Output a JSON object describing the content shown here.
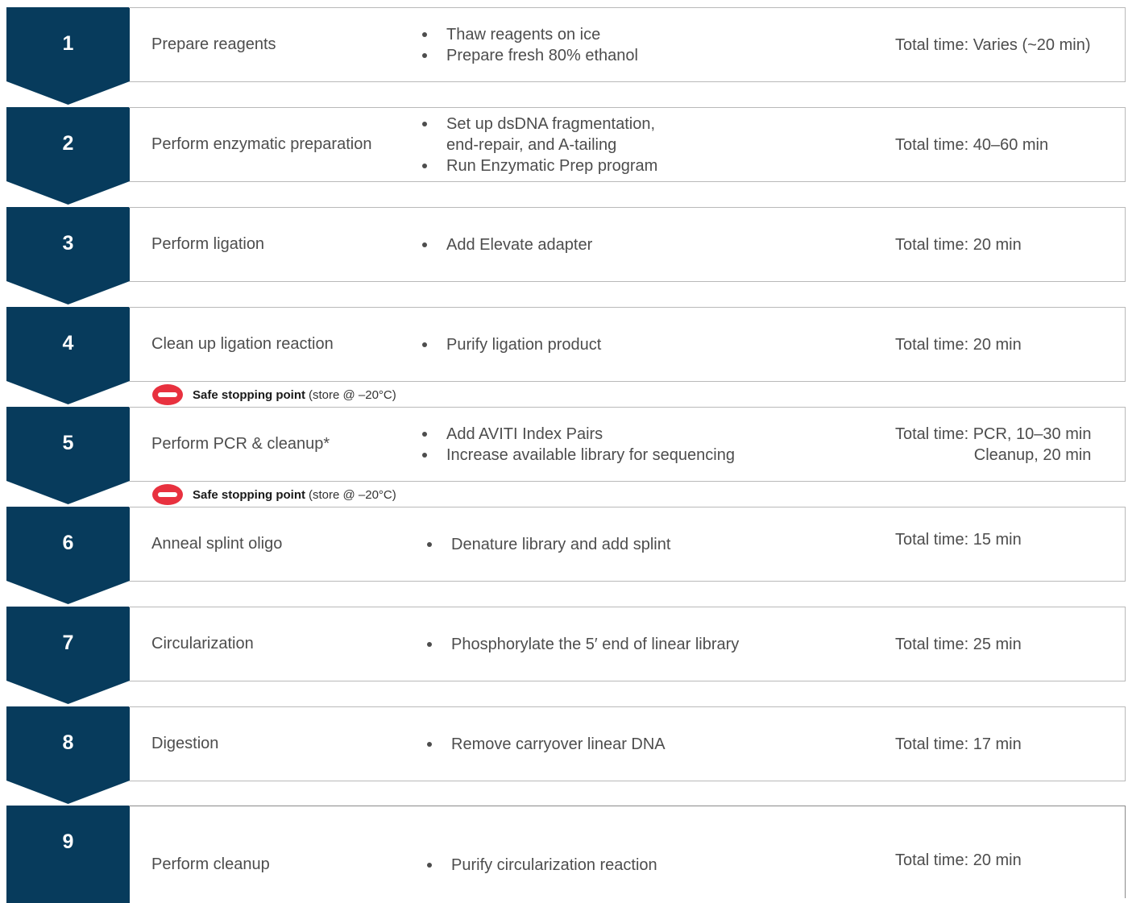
{
  "colors": {
    "accent": "#073b5c",
    "stop": "#e8313f",
    "border": "#b9b9b9"
  },
  "steps": [
    {
      "number": "1",
      "title": "Prepare reagents",
      "bullets": [
        "Thaw reagents on ice",
        "Prepare fresh 80% ethanol"
      ],
      "time": [
        "Total time: Varies (~20 min)"
      ]
    },
    {
      "number": "2",
      "title": "Perform enzymatic preparation",
      "bullets": [
        "Set up dsDNA fragmentation, end-repair, and A-tailing",
        "Run Enzymatic Prep program"
      ],
      "time": [
        "Total time: 40–60 min"
      ]
    },
    {
      "number": "3",
      "title": "Perform ligation",
      "bullets": [
        "Add Elevate adapter"
      ],
      "time": [
        "Total time: 20 min"
      ]
    },
    {
      "number": "4",
      "title": "Clean up ligation reaction",
      "bullets": [
        "Purify ligation product"
      ],
      "time": [
        "Total time: 20 min"
      ]
    },
    {
      "number": "5",
      "title": "Perform PCR  & cleanup*",
      "bullets": [
        "Add AVITI Index Pairs",
        "Increase available library for sequencing"
      ],
      "time": [
        "Total time: PCR, 10–30 min",
        "Cleanup, 20 min"
      ]
    },
    {
      "number": "6",
      "title": "Anneal splint oligo",
      "bullets": [
        "Denature library and add splint"
      ],
      "time": [
        "Total time: 15 min"
      ]
    },
    {
      "number": "7",
      "title": "Circularization",
      "bullets": [
        "Phosphorylate the 5′ end of linear library"
      ],
      "time": [
        "Total time: 25 min"
      ]
    },
    {
      "number": "8",
      "title": "Digestion",
      "bullets": [
        "Remove carryover linear DNA"
      ],
      "time": [
        "Total time: 17 min"
      ]
    },
    {
      "number": "9",
      "title": "Perform cleanup",
      "bullets": [
        "Purify circularization reaction"
      ],
      "time": [
        "Total time: 20 min"
      ]
    }
  ],
  "stops": [
    {
      "label": "Safe stopping point",
      "detail": "(store @ –20°C)"
    },
    {
      "label": "Safe stopping point",
      "detail": "(store @ –20°C)"
    }
  ]
}
